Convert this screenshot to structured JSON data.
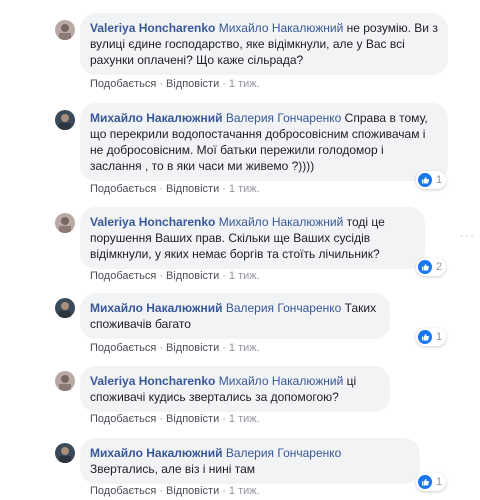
{
  "comments": [
    {
      "author": "Valeriya Honcharenko",
      "mention": "Михайло Накалюжний",
      "text": " не розумію. Ви з вулиці єдине господарство, яке відімкнули, але у Вас всі рахунки оплачені? Що каже сільрада?",
      "actions": {
        "like": "Подобається",
        "reply": "Відповісти",
        "time": "1 тиж."
      },
      "reactions": null
    },
    {
      "author": "Михайло Накалюжний",
      "mention": "Валерия Гончаренко",
      "text": " Справа в тому, що перекрили водопостачання добросовісним споживачам і не добросовісним. Мої батьки пережили голодомор і заслання , то в яки часи ми живемо ?))))",
      "actions": {
        "like": "Подобається",
        "reply": "Відповісти",
        "time": "1 тиж."
      },
      "reactions": "1"
    },
    {
      "author": "Valeriya Honcharenko",
      "mention": "Михайло Накалюжний",
      "text": " тоді це порушення Ваших прав. Скільки ще Ваших сусідів відімкнули, у яких немає боргів та стоїть лічильник?",
      "actions": {
        "like": "Подобається",
        "reply": "Відповісти",
        "time": "1 тиж."
      },
      "reactions": "2"
    },
    {
      "author": "Михайло Накалюжний",
      "mention": "Валерия Гончаренко",
      "text": " Таких споживачів багато",
      "actions": {
        "like": "Подобається",
        "reply": "Відповісти",
        "time": "1 тиж."
      },
      "reactions": "1"
    },
    {
      "author": "Valeriya Honcharenko",
      "mention": "Михайло Накалюжний",
      "text": " ці споживачі кудись звертались за допомогою?",
      "actions": {
        "like": "Подобається",
        "reply": "Відповісти",
        "time": "1 тиж."
      },
      "reactions": null
    },
    {
      "author": "Михайло Накалюжний",
      "mention": "Валерия Гончаренко",
      "text": " Звертались, але віз і нині там",
      "actions": {
        "like": "Подобається",
        "reply": "Відповісти",
        "time": "1 тиж."
      },
      "reactions": "1"
    }
  ],
  "more_options_glyph": "···"
}
